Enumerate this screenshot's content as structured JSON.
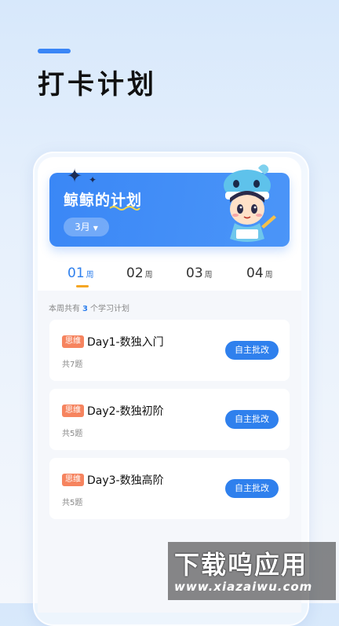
{
  "page": {
    "title": "打卡计划"
  },
  "banner": {
    "title": "鲸鲸的计划",
    "month": "3月"
  },
  "tabs": [
    {
      "num": "01",
      "unit": "周"
    },
    {
      "num": "02",
      "unit": "周"
    },
    {
      "num": "03",
      "unit": "周"
    },
    {
      "num": "04",
      "unit": "周"
    }
  ],
  "summary": {
    "prefix": "本周共有",
    "count": "3",
    "suffix": "个学习计划"
  },
  "plans": [
    {
      "tag": "思维",
      "title": "Day1-数独入门",
      "sub": "共7题",
      "button": "自主批改"
    },
    {
      "tag": "思维",
      "title": "Day2-数独初阶",
      "sub": "共5题",
      "button": "自主批改"
    },
    {
      "tag": "思维",
      "title": "Day3-数独高阶",
      "sub": "共5题",
      "button": "自主批改"
    }
  ],
  "watermark": {
    "main": "下载呜应用",
    "url": "www.xiazaiwu.com"
  },
  "colors": {
    "accent": "#2f80ed",
    "tag": "#f6845f",
    "indicator": "#f5a623"
  }
}
